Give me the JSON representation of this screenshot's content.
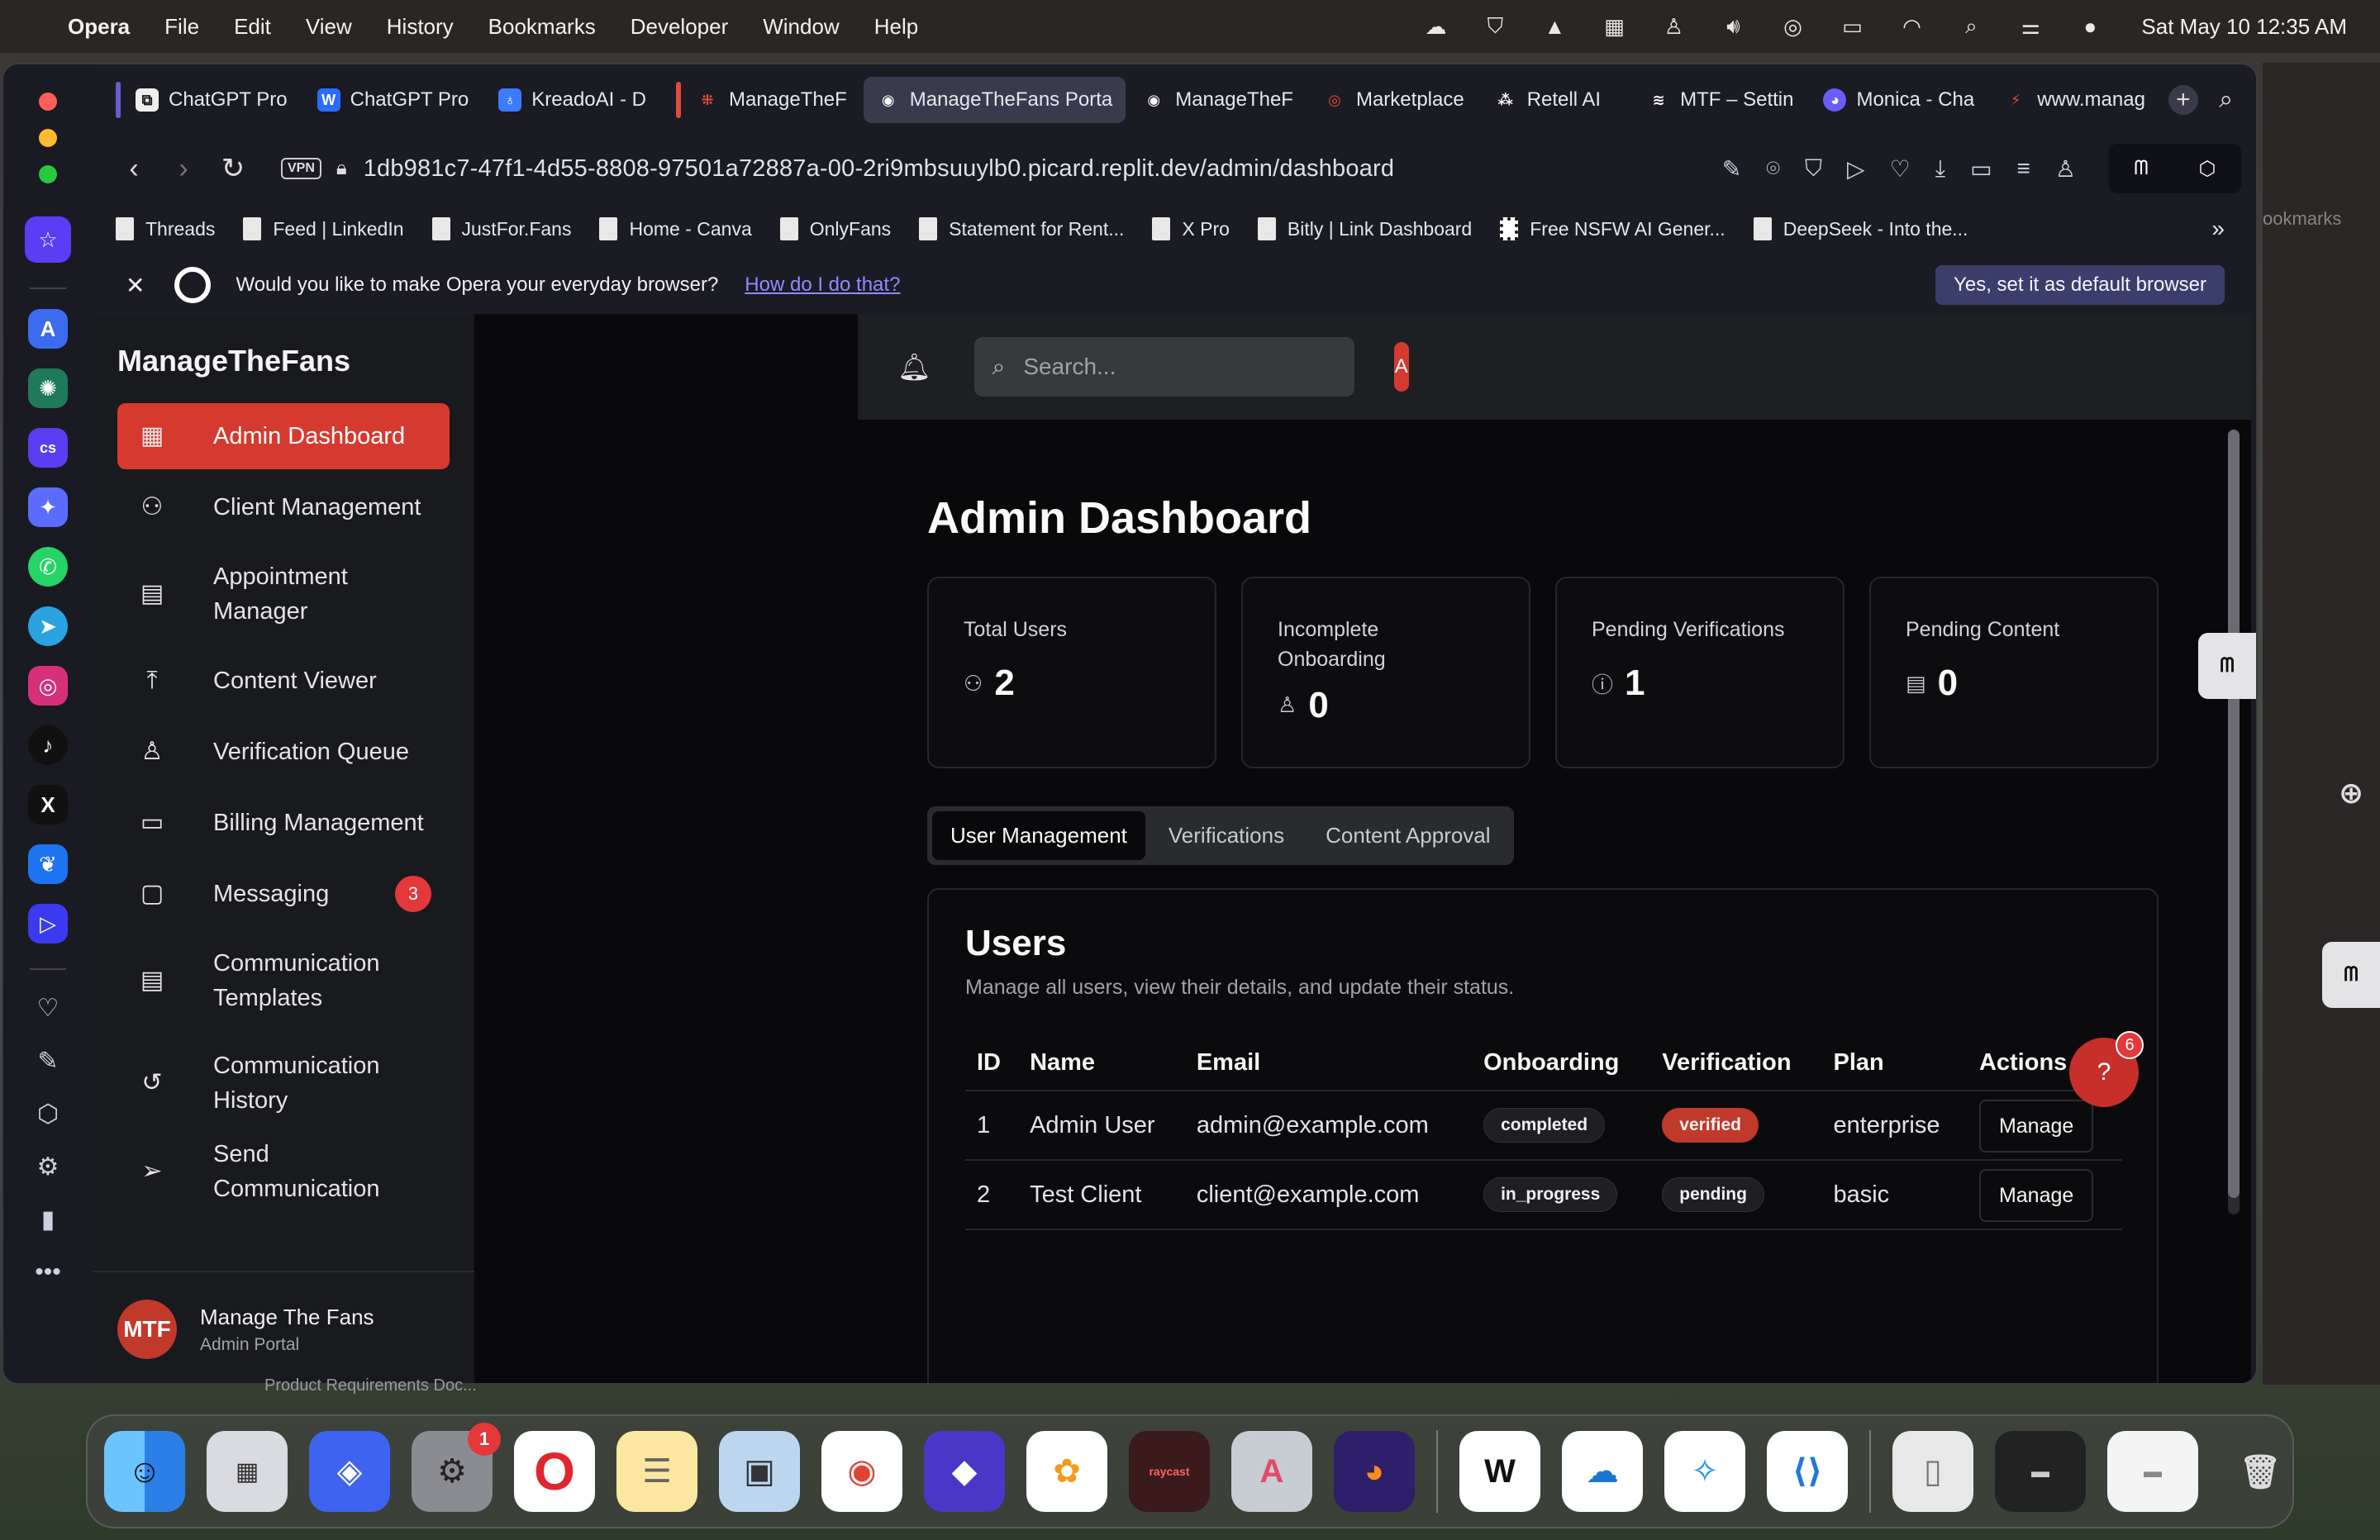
{
  "menubar": {
    "app": "Opera",
    "items": [
      "File",
      "Edit",
      "View",
      "History",
      "Bookmarks",
      "Developer",
      "Window",
      "Help"
    ],
    "clock": "Sat May 10  12:35 AM"
  },
  "tabs": [
    {
      "label": "ChatGPT Pro",
      "color": "#6a5acd"
    },
    {
      "label": "ChatGPT Pro",
      "color": "#2b6cff"
    },
    {
      "label": "KreadoAI - D",
      "color": "#3b7bff"
    },
    {
      "label": "ManageTheF",
      "color": "#e24a3b"
    },
    {
      "label": "ManageTheFans Porta",
      "color": "#ffffff"
    },
    {
      "label": "ManageTheF",
      "color": "#ffffff"
    },
    {
      "label": "Marketplace",
      "color": "#e24a3b"
    },
    {
      "label": "Retell AI",
      "color": "#ffffff"
    },
    {
      "label": "MTF – Settin",
      "color": "#ffffff"
    },
    {
      "label": "Monica - Cha",
      "color": "#6b5cff"
    },
    {
      "label": "www.manag",
      "color": "#e24a3b"
    }
  ],
  "address": {
    "vpn": "VPN",
    "url": "1db981c7-47f1-4d55-8808-97501a72887a-00-2ri9mbsuuylb0.picard.replit.dev/admin/dashboard"
  },
  "bookmarks": [
    "Threads",
    "Feed | LinkedIn",
    "JustFor.Fans",
    "Home - Canva",
    "OnlyFans",
    "Statement for Rent...",
    "X Pro",
    "Bitly | Link Dashboard",
    "Free NSFW AI Gener...",
    "DeepSeek - Into the..."
  ],
  "infobar": {
    "message": "Would you like to make Opera your everyday browser?",
    "link": "How do I do that?",
    "button": "Yes, set it as default browser"
  },
  "right_strip": {
    "label": "ookmarks"
  },
  "app": {
    "brand": "ManageTheFans",
    "nav": [
      {
        "label": "Admin Dashboard",
        "icon": "dashboard-icon"
      },
      {
        "label": "Client Management",
        "icon": "users-icon"
      },
      {
        "label": "Appointment Manager",
        "icon": "calendar-icon"
      },
      {
        "label": "Content Viewer",
        "icon": "upload-icon"
      },
      {
        "label": "Verification Queue",
        "icon": "user-plus-icon"
      },
      {
        "label": "Billing Management",
        "icon": "credit-card-icon"
      },
      {
        "label": "Messaging",
        "icon": "message-icon",
        "badge": "3"
      },
      {
        "label": "Communication Templates",
        "icon": "document-icon"
      },
      {
        "label": "Communication History",
        "icon": "history-icon"
      },
      {
        "label": "Send Communication",
        "icon": "send-icon"
      }
    ],
    "footer": {
      "avatar": "MTF",
      "name": "Manage The Fans",
      "role": "Admin Portal"
    },
    "search_placeholder": "Search...",
    "user_initial": "A",
    "page_title": "Admin Dashboard",
    "stats": [
      {
        "label": "Total Users",
        "value": "2",
        "icon": "users-icon"
      },
      {
        "label": "Incomplete Onboarding",
        "value": "0",
        "icon": "user-icon"
      },
      {
        "label": "Pending Verifications",
        "value": "1",
        "icon": "alert-circle-icon"
      },
      {
        "label": "Pending Content",
        "value": "0",
        "icon": "file-icon"
      }
    ],
    "segments": [
      "User Management",
      "Verifications",
      "Content Approval"
    ],
    "users_card": {
      "title": "Users",
      "description": "Manage all users, view their details, and update their status.",
      "columns": [
        "ID",
        "Name",
        "Email",
        "Onboarding",
        "Verification",
        "Plan",
        "Actions"
      ],
      "rows": [
        {
          "id": "1",
          "name": "Admin User",
          "email": "admin@example.com",
          "onboarding": "completed",
          "verification": "verified",
          "plan": "enterprise",
          "action": "Manage"
        },
        {
          "id": "2",
          "name": "Test Client",
          "email": "client@example.com",
          "onboarding": "in_progress",
          "verification": "pending",
          "plan": "basic",
          "action": "Manage"
        }
      ]
    },
    "help_count": "6"
  },
  "under_caption": "Product Requirements Doc...",
  "dock_badge": "1"
}
